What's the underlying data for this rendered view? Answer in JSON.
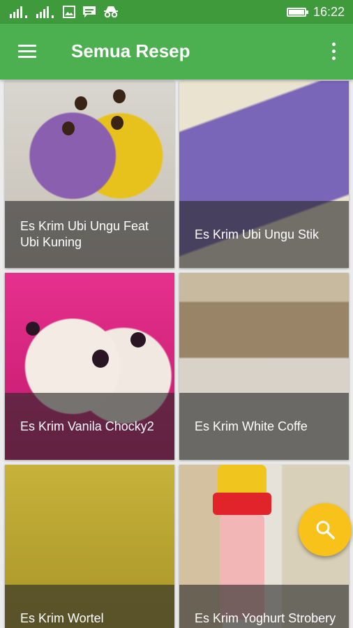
{
  "status_bar": {
    "time": "16:22",
    "battery_level": 1.0,
    "icons": [
      "signal-icon",
      "signal-icon",
      "image-icon",
      "chat-icon",
      "incognito-icon",
      "battery-icon"
    ]
  },
  "app_bar": {
    "title": "Semua Resep",
    "menu_icon": "menu-icon",
    "overflow_icon": "more-vert-icon",
    "color": "#4caf50"
  },
  "recipes": [
    {
      "title": "Es Krim Ubi Ungu Feat Ubi Kuning"
    },
    {
      "title": "Es Krim Ubi Ungu Stik"
    },
    {
      "title": "Es Krim Vanila Chocky2"
    },
    {
      "title": "Es Krim White Coffe"
    },
    {
      "title": "Es Krim Wortel"
    },
    {
      "title": "Es Krim Yoghurt Strobery"
    }
  ],
  "fab": {
    "icon": "search-icon",
    "color": "#f8c21b"
  }
}
